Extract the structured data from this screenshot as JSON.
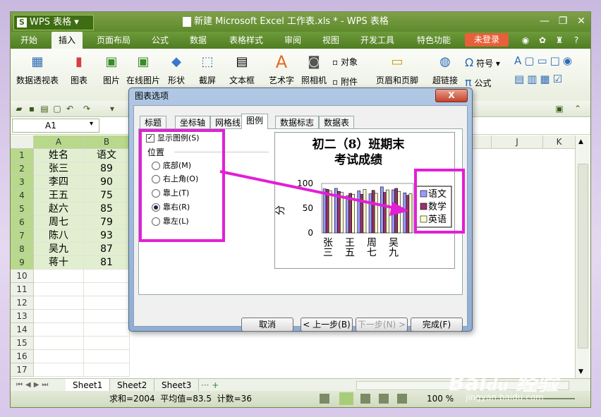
{
  "app": {
    "menu_label": "WPS 表格",
    "logo_letter": "S",
    "title": "新建 Microsoft Excel 工作表.xls * - WPS 表格"
  },
  "menus": [
    "开始",
    "插入",
    "页面布局",
    "公式",
    "数据",
    "表格样式",
    "审阅",
    "视图",
    "开发工具",
    "特色功能"
  ],
  "login_label": "未登录",
  "ribbon": {
    "buttons": [
      "数据透视表",
      "图表",
      "图片",
      "在线图片",
      "形状",
      "截屏",
      "文本框",
      "艺术字",
      "照相机",
      "页眉和页脚",
      "超链接"
    ],
    "small": [
      "对象",
      "附件",
      "符号",
      "公式"
    ]
  },
  "namebox": "A1",
  "columns": [
    "A",
    "B",
    "J",
    "K"
  ],
  "rows": [
    "1",
    "2",
    "3",
    "4",
    "5",
    "6",
    "7",
    "8",
    "9",
    "10",
    "11",
    "12",
    "13",
    "14",
    "15",
    "16",
    "17"
  ],
  "table": {
    "headers": [
      "姓名",
      "语文"
    ],
    "rows": [
      [
        "张三",
        "89"
      ],
      [
        "李四",
        "90"
      ],
      [
        "王五",
        "75"
      ],
      [
        "赵六",
        "85"
      ],
      [
        "周七",
        "79"
      ],
      [
        "陈八",
        "93"
      ],
      [
        "吴九",
        "87"
      ],
      [
        "蒋十",
        "81"
      ]
    ]
  },
  "sheets": [
    "Sheet1",
    "Sheet2",
    "Sheet3"
  ],
  "status": {
    "summary": "求和=2004  平均值=83.5  计数=36",
    "zoom": "100 %"
  },
  "dialog": {
    "title": "图表选项",
    "close": "X",
    "tabs": [
      "标题",
      "坐标轴",
      "网格线",
      "图例",
      "数据标志",
      "数据表"
    ],
    "show_legend": "显示图例(S)",
    "position_label": "位置",
    "positions": [
      "底部(M)",
      "右上角(O)",
      "靠上(T)",
      "靠右(R)",
      "靠左(L)"
    ],
    "buttons": {
      "cancel": "取消",
      "prev": "< 上一步(B)",
      "next": "下一步(N) >",
      "finish": "完成(F)"
    }
  },
  "chart_data": {
    "type": "bar",
    "title": "初二（8）班期末考试成绩",
    "ylabel": "分",
    "ylim": [
      0,
      100
    ],
    "yticks": [
      "100",
      "50",
      "0"
    ],
    "x_labels": [
      "张三",
      "王五",
      "周七",
      "吴九"
    ],
    "categories": [
      "张三",
      "李四",
      "王五",
      "赵六",
      "周七",
      "陈八",
      "吴九",
      "蒋十"
    ],
    "series": [
      {
        "name": "语文",
        "color": "#9999ff",
        "values": [
          89,
          90,
          75,
          85,
          79,
          93,
          87,
          81
        ]
      },
      {
        "name": "数学",
        "color": "#993366",
        "values": [
          88,
          84,
          80,
          78,
          86,
          82,
          90,
          76
        ]
      },
      {
        "name": "英语",
        "color": "#ffffcc",
        "values": [
          85,
          82,
          78,
          88,
          80,
          87,
          84,
          79
        ]
      }
    ]
  },
  "colors": {
    "highlight": "#e21fd6",
    "titlebar": "#6d9a3a",
    "login": "#e7603b"
  },
  "watermark": "Baidu 经验 jingyan.baidu.com"
}
